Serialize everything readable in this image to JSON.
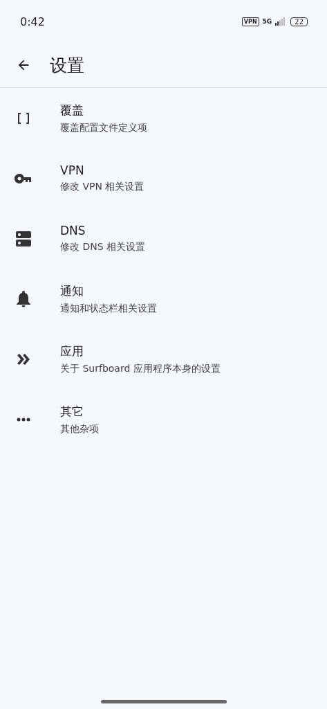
{
  "status_bar": {
    "time": "0:42",
    "vpn_badge": "VPN",
    "network": "5G",
    "battery": "22"
  },
  "app_bar": {
    "title": "设置"
  },
  "items": [
    {
      "kind": "brackets",
      "title": "覆盖",
      "subtitle": "覆盖配置文件定义项"
    },
    {
      "kind": "key",
      "title": "VPN",
      "subtitle": "修改 VPN 相关设置"
    },
    {
      "kind": "dns",
      "title": "DNS",
      "subtitle": "修改 DNS 相关设置"
    },
    {
      "kind": "bell",
      "title": "通知",
      "subtitle": "通知和状态栏相关设置"
    },
    {
      "kind": "chevrons",
      "title": "应用",
      "subtitle": "关于 Surfboard 应用程序本身的设置"
    },
    {
      "kind": "dots",
      "title": "其它",
      "subtitle": "其他杂项"
    }
  ]
}
